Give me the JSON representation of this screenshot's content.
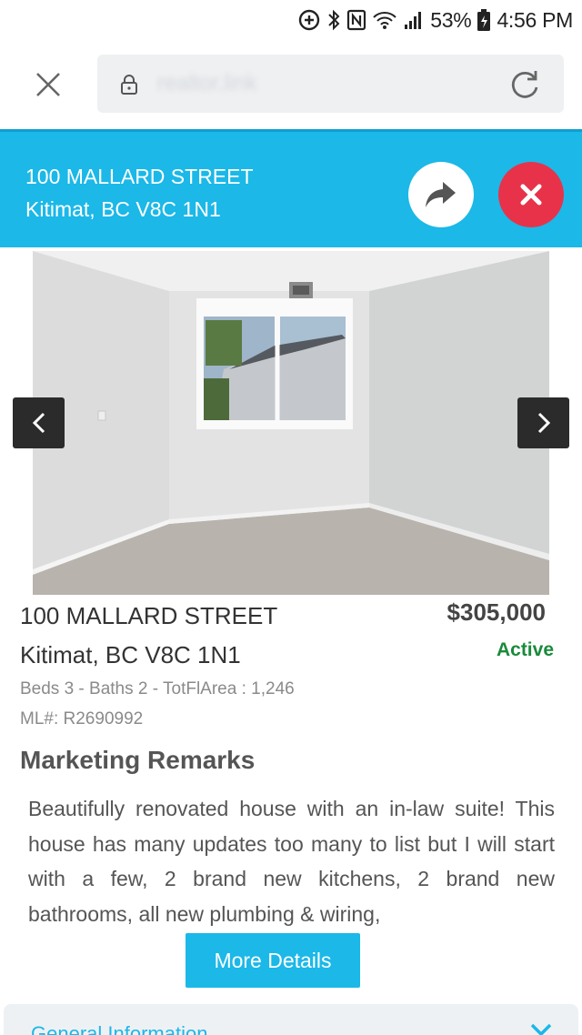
{
  "status_bar": {
    "battery_percent": "53%",
    "time": "4:56 PM",
    "icons": [
      "data-saver-icon",
      "bluetooth-icon",
      "nfc-icon",
      "wifi-icon",
      "signal-icon",
      "battery-icon"
    ]
  },
  "browser": {
    "url_text": "realtor.link"
  },
  "header": {
    "street": "100 MALLARD STREET",
    "city": "Kitimat, BC V8C 1N1",
    "accent_color": "#1bb8e8",
    "close_color": "#e8324a"
  },
  "listing": {
    "street": "100 MALLARD STREET",
    "city": "Kitimat, BC V8C 1N1",
    "price": "$305,000",
    "status": "Active",
    "status_color": "#1a8a3c",
    "specs": "Beds 3 - Baths 2 - TotFlArea : 1,246",
    "mls": "ML#: R2690992"
  },
  "remarks": {
    "title": "Marketing Remarks",
    "text": "Beautifully renovated house with an in-law suite! This house has many updates too many to list but I will start with a few, 2 brand new kitchens, 2 brand new bathrooms, all new plumbing & wiring,"
  },
  "actions": {
    "more_details_label": "More Details"
  },
  "accordion": {
    "label": "General Information"
  }
}
